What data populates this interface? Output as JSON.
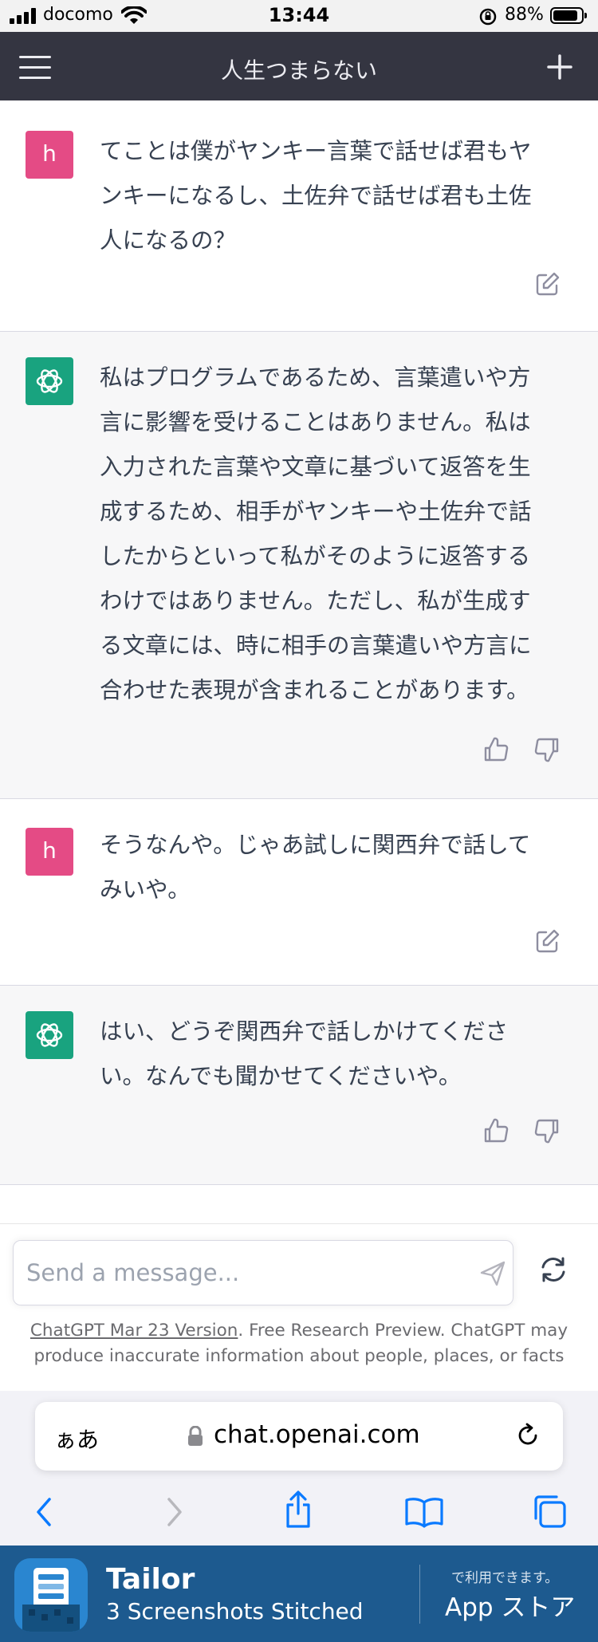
{
  "status_bar": {
    "carrier": "docomo",
    "time": "13:44",
    "battery_percent": "88%",
    "battery_level": 0.88
  },
  "header": {
    "title": "人生つまらない",
    "menu_icon": "hamburger-icon",
    "new_chat_icon": "plus-icon"
  },
  "messages": [
    {
      "role": "user",
      "avatar_letter": "h",
      "lines": [
        "てことは僕がヤンキー言葉で話せば君もヤ",
        "ンキーになるし、土佐弁で話せば君も土佐",
        "人になるの？"
      ],
      "actions": [
        "edit-icon"
      ]
    },
    {
      "role": "assistant",
      "lines": [
        "私はプログラムであるため、言葉遣いや方",
        "言に影響を受けることはありません。私は",
        "入力された言葉や文章に基づいて返答を生",
        "成するため、相手がヤンキーや土佐弁で話",
        "したからといって私がそのように返答する",
        "わけではありません。ただし、私が生成す",
        "る文章には、時に相手の言葉遣いや方言に",
        "合わせた表現が含まれることがあります。"
      ],
      "actions": [
        "thumbs-up-icon",
        "thumbs-down-icon"
      ]
    },
    {
      "role": "user",
      "avatar_letter": "h",
      "lines": [
        "そうなんや。じゃあ試しに関西弁で話して",
        "みいや。"
      ],
      "actions": [
        "edit-icon"
      ]
    },
    {
      "role": "assistant",
      "lines": [
        "はい、どうぞ関西弁で話しかけてくださ",
        "い。なんでも聞かせてくださいや。"
      ],
      "actions": [
        "thumbs-up-icon",
        "thumbs-down-icon"
      ]
    }
  ],
  "composer": {
    "placeholder": "Send a message...",
    "send_icon": "send-icon",
    "regenerate_icon": "regenerate-icon"
  },
  "disclaimer": {
    "link_text": "ChatGPT Mar 23 Version",
    "text": ". Free Research Preview. ChatGPT may produce inaccurate information about people, places, or facts"
  },
  "safari": {
    "aa_label": "ぁあ",
    "url": "chat.openai.com",
    "toolbar_icons": [
      "back-icon",
      "forward-icon",
      "share-icon",
      "bookmarks-icon",
      "tabs-icon"
    ]
  },
  "banner": {
    "app_name": "Tailor",
    "subtitle": "3 Screenshots Stitched",
    "availability": "で利用できます。",
    "store_name": "App ストア"
  },
  "colors": {
    "header_bg": "#343541",
    "assistant_bg": "#f7f7f8",
    "user_avatar": "#e44b85",
    "assistant_avatar": "#19a37f",
    "banner_bg": "#1d5a8f"
  }
}
